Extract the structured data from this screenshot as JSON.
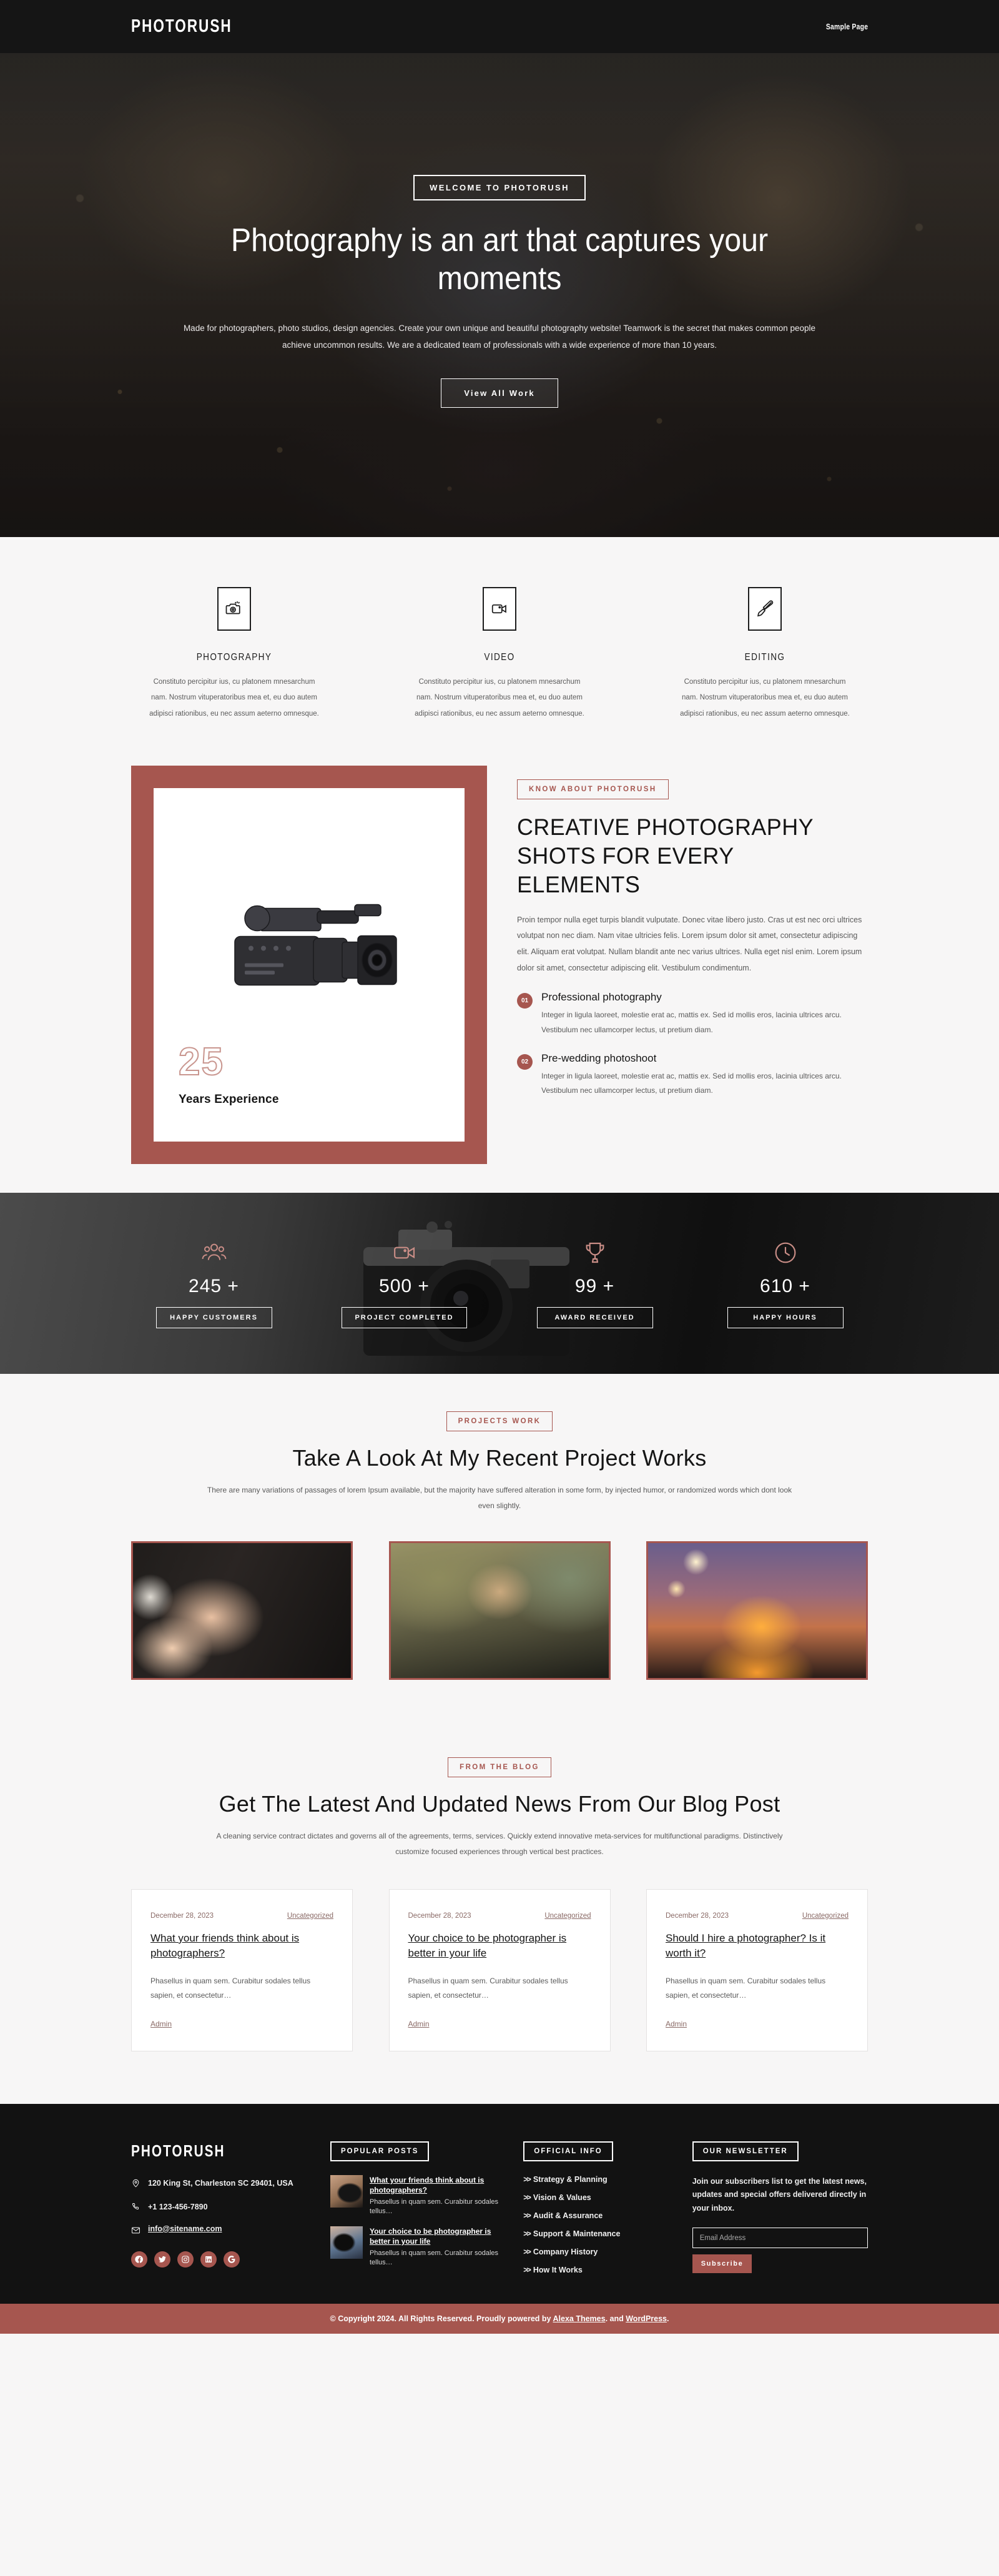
{
  "header": {
    "logo": "PHOTORUSH",
    "nav": [
      {
        "label": "Sample Page"
      }
    ]
  },
  "hero": {
    "badge": "WELCOME TO PHOTORUSH",
    "title": "Photography is an art that captures your moments",
    "subtitle": "Made for photographers, photo studios, design agencies. Create your own unique and beautiful photography website! Teamwork is the secret that makes common people achieve uncommon results. We are a dedicated team of professionals with a wide experience of more than 10 years.",
    "button": "View All Work"
  },
  "services": [
    {
      "icon": "camera-icon",
      "title": "PHOTOGRAPHY",
      "text": "Constituto percipitur ius, cu platonem mnesarchum nam. Nostrum vituperatoribus mea et, eu duo autem adipisci rationibus, eu nec assum aeterno omnesque."
    },
    {
      "icon": "video-camera-icon",
      "title": "VIDEO",
      "text": "Constituto percipitur ius, cu platonem mnesarchum nam. Nostrum vituperatoribus mea et, eu duo autem adipisci rationibus, eu nec assum aeterno omnesque."
    },
    {
      "icon": "paint-brush-icon",
      "title": "EDITING",
      "text": "Constituto percipitur ius, cu platonem mnesarchum nam. Nostrum vituperatoribus mea et, eu duo autem adipisci rationibus, eu nec assum aeterno omnesque."
    }
  ],
  "about": {
    "experience_number": "25",
    "experience_label": "Years Experience",
    "eyebrow": "KNOW ABOUT PHOTORUSH",
    "heading": "CREATIVE PHOTOGRAPHY SHOTS FOR EVERY ELEMENTS",
    "paragraph": "Proin tempor nulla eget turpis blandit vulputate. Donec vitae libero justo. Cras ut est nec orci ultrices volutpat non nec diam. Nam vitae ultricies felis. Lorem ipsum dolor sit amet, consectetur adipiscing elit. Aliquam erat volutpat. Nullam blandit ante nec varius ultrices. Nulla eget nisl enim. Lorem ipsum dolor sit amet, consectetur adipiscing elit. Vestibulum condimentum.",
    "features": [
      {
        "number": "01",
        "title": "Professional photography",
        "text": "Integer in ligula laoreet, molestie erat ac, mattis ex. Sed id mollis eros, lacinia ultrices arcu. Vestibulum nec ullamcorper lectus, ut pretium diam."
      },
      {
        "number": "02",
        "title": "Pre-wedding photoshoot",
        "text": "Integer in ligula laoreet, molestie erat ac, mattis ex. Sed id mollis eros, lacinia ultrices arcu. Vestibulum nec ullamcorper lectus, ut pretium diam."
      }
    ]
  },
  "stats": [
    {
      "icon": "users-icon",
      "value": "245 +",
      "label": "HAPPY CUSTOMERS"
    },
    {
      "icon": "video-camera-icon",
      "value": "500 +",
      "label": "PROJECT COMPLETED"
    },
    {
      "icon": "trophy-icon",
      "value": "99 +",
      "label": "AWARD RECEIVED"
    },
    {
      "icon": "clock-icon",
      "value": "610 +",
      "label": "HAPPY HOURS"
    }
  ],
  "projects": {
    "eyebrow": "PROJECTS WORK",
    "heading": "Take A Look At My Recent Project Works",
    "paragraph": "There are many variations of passages of lorem Ipsum available, but the majority have suffered alteration in some form, by injected humor, or randomized words which dont look even slightly.",
    "items": [
      {
        "alt": "wedding-rings-hands-photo"
      },
      {
        "alt": "photographer-with-camera-photo"
      },
      {
        "alt": "woman-with-city-lights-photo"
      }
    ]
  },
  "blog": {
    "eyebrow": "FROM THE BLOG",
    "heading": "Get The Latest And Updated News From Our Blog Post",
    "paragraph": "A cleaning service contract dictates and governs all of the agreements, terms, services. Quickly extend innovative meta-services for multifunctional paradigms. Distinctively customize focused experiences through vertical best practices.",
    "posts": [
      {
        "date": "December 28, 2023",
        "category": "Uncategorized",
        "title": "What your friends think about is photographers?",
        "excerpt": "Phasellus in quam sem. Curabitur sodales tellus sapien, et consectetur…",
        "author": "Admin"
      },
      {
        "date": "December 28, 2023",
        "category": "Uncategorized",
        "title": "Your choice to be photographer is better in your life",
        "excerpt": "Phasellus in quam sem. Curabitur sodales tellus sapien, et consectetur…",
        "author": "Admin"
      },
      {
        "date": "December 28, 2023",
        "category": "Uncategorized",
        "title": "Should I hire a photographer? Is it worth it?",
        "excerpt": "Phasellus in quam sem. Curabitur sodales tellus sapien, et consectetur…",
        "author": "Admin"
      }
    ]
  },
  "footer": {
    "logo": "PHOTORUSH",
    "address": "120 King St, Charleston SC 29401, USA",
    "phone": "+1 123-456-7890",
    "email": "info@sitename.com",
    "socials": [
      "facebook-icon",
      "twitter-icon",
      "instagram-icon",
      "linkedin-icon",
      "google-icon"
    ],
    "popular": {
      "heading": "POPULAR POSTS",
      "items": [
        {
          "title": "What your friends think about is photographers?",
          "excerpt": "Phasellus in quam sem. Curabitur sodales tellus…"
        },
        {
          "title": "Your choice to be photographer is better in your life",
          "excerpt": "Phasellus in quam sem. Curabitur sodales tellus…"
        }
      ]
    },
    "official": {
      "heading": "OFFICIAL INFO",
      "links": [
        "Strategy & Planning",
        "Vision & Values",
        "Audit & Assurance",
        "Support & Maintenance",
        "Company History",
        "How It Works"
      ]
    },
    "newsletter": {
      "heading": "OUR NEWSLETTER",
      "text": "Join our subscribers list to get the latest news, updates and special offers delivered directly in your inbox.",
      "placeholder": "Email Address",
      "button": "Subscribe"
    },
    "copyright_prefix": "© Copyright 2024. All Rights Reserved.  Proudly powered by ",
    "copyright_link1": "Alexa Themes",
    "copyright_mid": ". and ",
    "copyright_link2": "WordPress",
    "copyright_suffix": "."
  },
  "colors": {
    "accent": "#a6564f",
    "dark": "#121212",
    "page_bg": "#f7f6f6"
  }
}
